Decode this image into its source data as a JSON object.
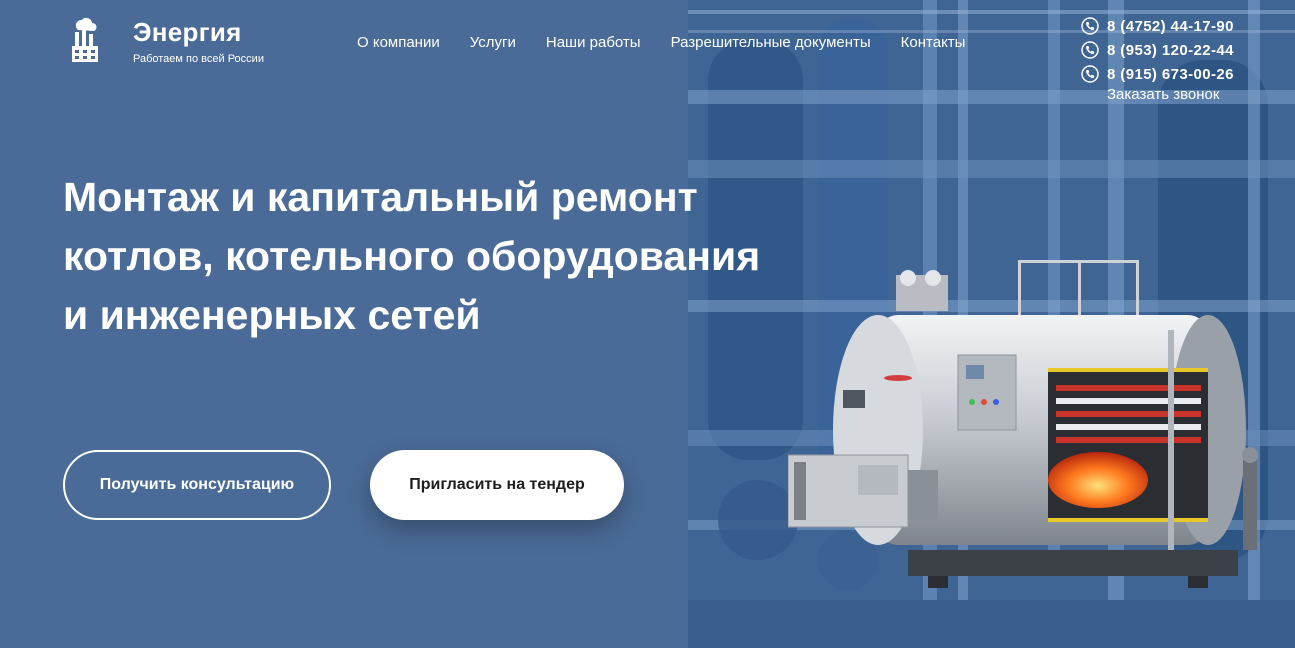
{
  "brand": {
    "name": "Энергия",
    "tagline": "Работаем по всей России",
    "logo_icon": "factory-icon"
  },
  "nav": {
    "items": [
      {
        "label": "О компании"
      },
      {
        "label": "Услуги"
      },
      {
        "label": "Наши работы"
      },
      {
        "label": "Разрешительные документы"
      },
      {
        "label": "Контакты"
      }
    ]
  },
  "contacts": {
    "phone_icon": "phone-icon",
    "phones": [
      "8 (4752) 44-17-90",
      "8 (953) 120-22-44",
      "8 (915) 673-00-26"
    ],
    "callback_label": "Заказать звонок"
  },
  "hero": {
    "headline_lines": [
      "Монтаж и капитальный ремонт",
      "котлов, котельного оборудования",
      "и инженерных сетей"
    ],
    "cta_primary": "Получить консультацию",
    "cta_secondary": "Пригласить на тендер",
    "image_icon": "industrial-boiler-image"
  },
  "colors": {
    "hero_bg": "#4a6b97",
    "text": "#ffffff",
    "button_text_dark": "#1d1d1d",
    "flame": "#ff6a1a"
  }
}
